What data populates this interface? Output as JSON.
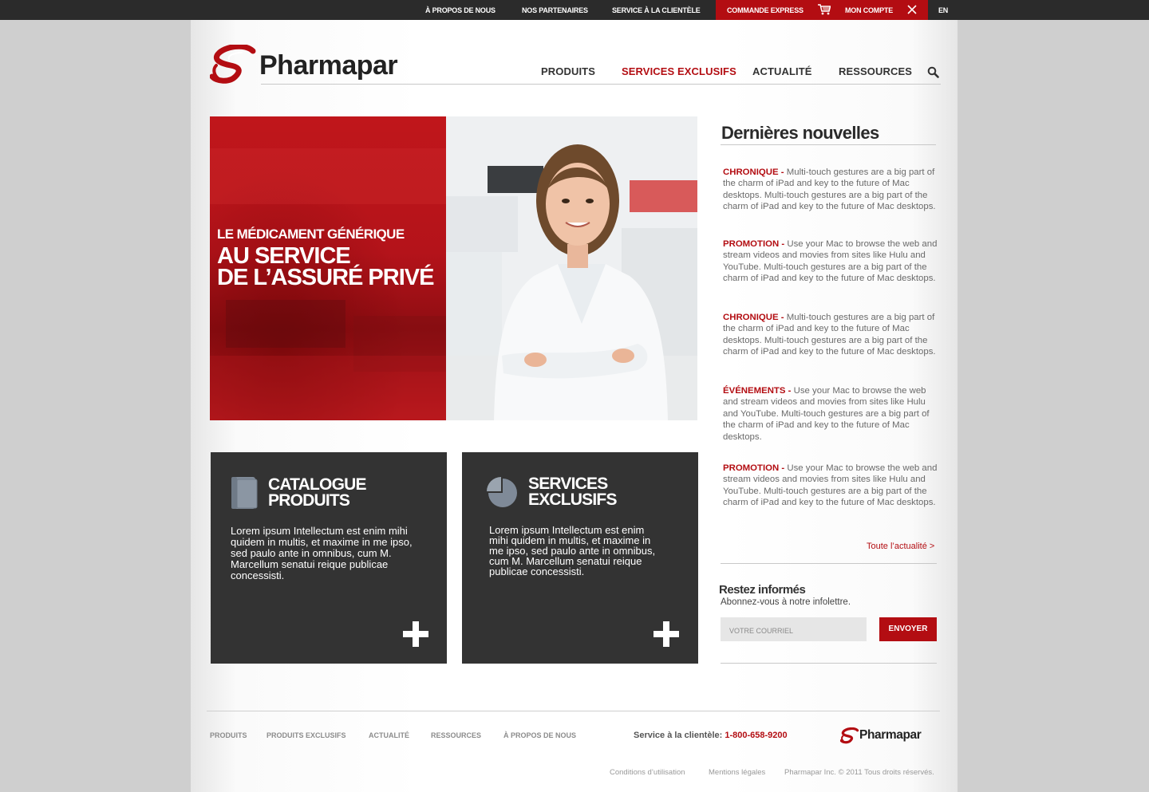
{
  "topbar": {
    "about": "À PROPOS DE NOUS",
    "partners": "NOS PARTENAIRES",
    "customer_service": "SERVICE À LA CLIENTÈLE",
    "express_order": "COMMANDE EXPRESS",
    "my_account": "MON COMPTE",
    "lang": "EN"
  },
  "brand": {
    "name": "Pharmapar",
    "color": "#b30d12"
  },
  "nav": {
    "items": [
      "PRODUITS",
      "SERVICES EXCLUSIFS",
      "ACTUALITÉ",
      "RESSOURCES"
    ],
    "active": "SERVICES EXCLUSIFS"
  },
  "hero": {
    "line1": "LE MÉDICAMENT GÉNÉRIQUE",
    "line2": "AU SERVICE",
    "line3": "DE L’ASSURÉ PRIVÉ"
  },
  "features": [
    {
      "title1": "CATALOGUE",
      "title2": "PRODUITS",
      "body": "Lorem ipsum Intellectum est enim mihi quidem in multis, et maxime in me ipso, sed paulo ante in omnibus, cum M. Marcellum senatui reique publicae concessisti.",
      "icon": "book-icon"
    },
    {
      "title1": "SERVICES",
      "title2": "EXCLUSIFS",
      "body": "Lorem ipsum Intellectum est enim mihi quidem in multis, et maxime in me ipso, sed paulo ante in omnibus, cum M. Marcellum senatui reique publicae concessisti.",
      "icon": "pie-chart-icon"
    }
  ],
  "news": {
    "title": "Dernières nouvelles",
    "items": [
      {
        "category": "CHRONIQUE -",
        "text": " Multi-touch gestures are a big part of the charm of iPad and key to the future of Mac desktops. Multi-touch gestures are a big part of the charm of iPad and key to the future of Mac desktops."
      },
      {
        "category": "PROMOTION -",
        "text": " Use your Mac to browse the web and stream videos and movies from sites like Hulu and YouTube. Multi-touch gestures are a big part of the charm of iPad and key to the future of Mac desktops."
      },
      {
        "category": "CHRONIQUE -",
        "text": " Multi-touch gestures are a big part of the charm of iPad and key to the future of Mac desktops. Multi-touch gestures are a big part of the charm of iPad and key to the future of Mac desktops."
      },
      {
        "category": "ÉVÉNEMENTS -",
        "text": " Use your Mac to browse the web and stream videos and movies from sites like Hulu and YouTube. Multi-touch gestures are a big part of the charm of iPad and key to the future of Mac desktops."
      },
      {
        "category": "PROMOTION -",
        "text": " Use your Mac to browse the web and stream videos and movies from sites like Hulu and YouTube. Multi-touch gestures are a big part of the charm of iPad and key to the future of Mac desktops."
      }
    ],
    "all_link": "Toute l’actualité >"
  },
  "newsletter": {
    "title": "Restez informés",
    "subtitle": "Abonnez-vous à notre infolettre.",
    "placeholder": "VOTRE COURRIEL",
    "button": "ENVOYER"
  },
  "footer": {
    "links": [
      "PRODUITS",
      "PRODUITS EXCLUSIFS",
      "ACTUALITÉ",
      "RESSOURCES",
      "À PROPOS DE NOUS"
    ],
    "service_label": "Service à la clientèle:",
    "phone": "1-800-658-9200",
    "terms": "Conditions d’utilisation",
    "legal": "Mentions légales",
    "copyright": "Pharmapar Inc. © 2011 Tous droits réservés."
  }
}
